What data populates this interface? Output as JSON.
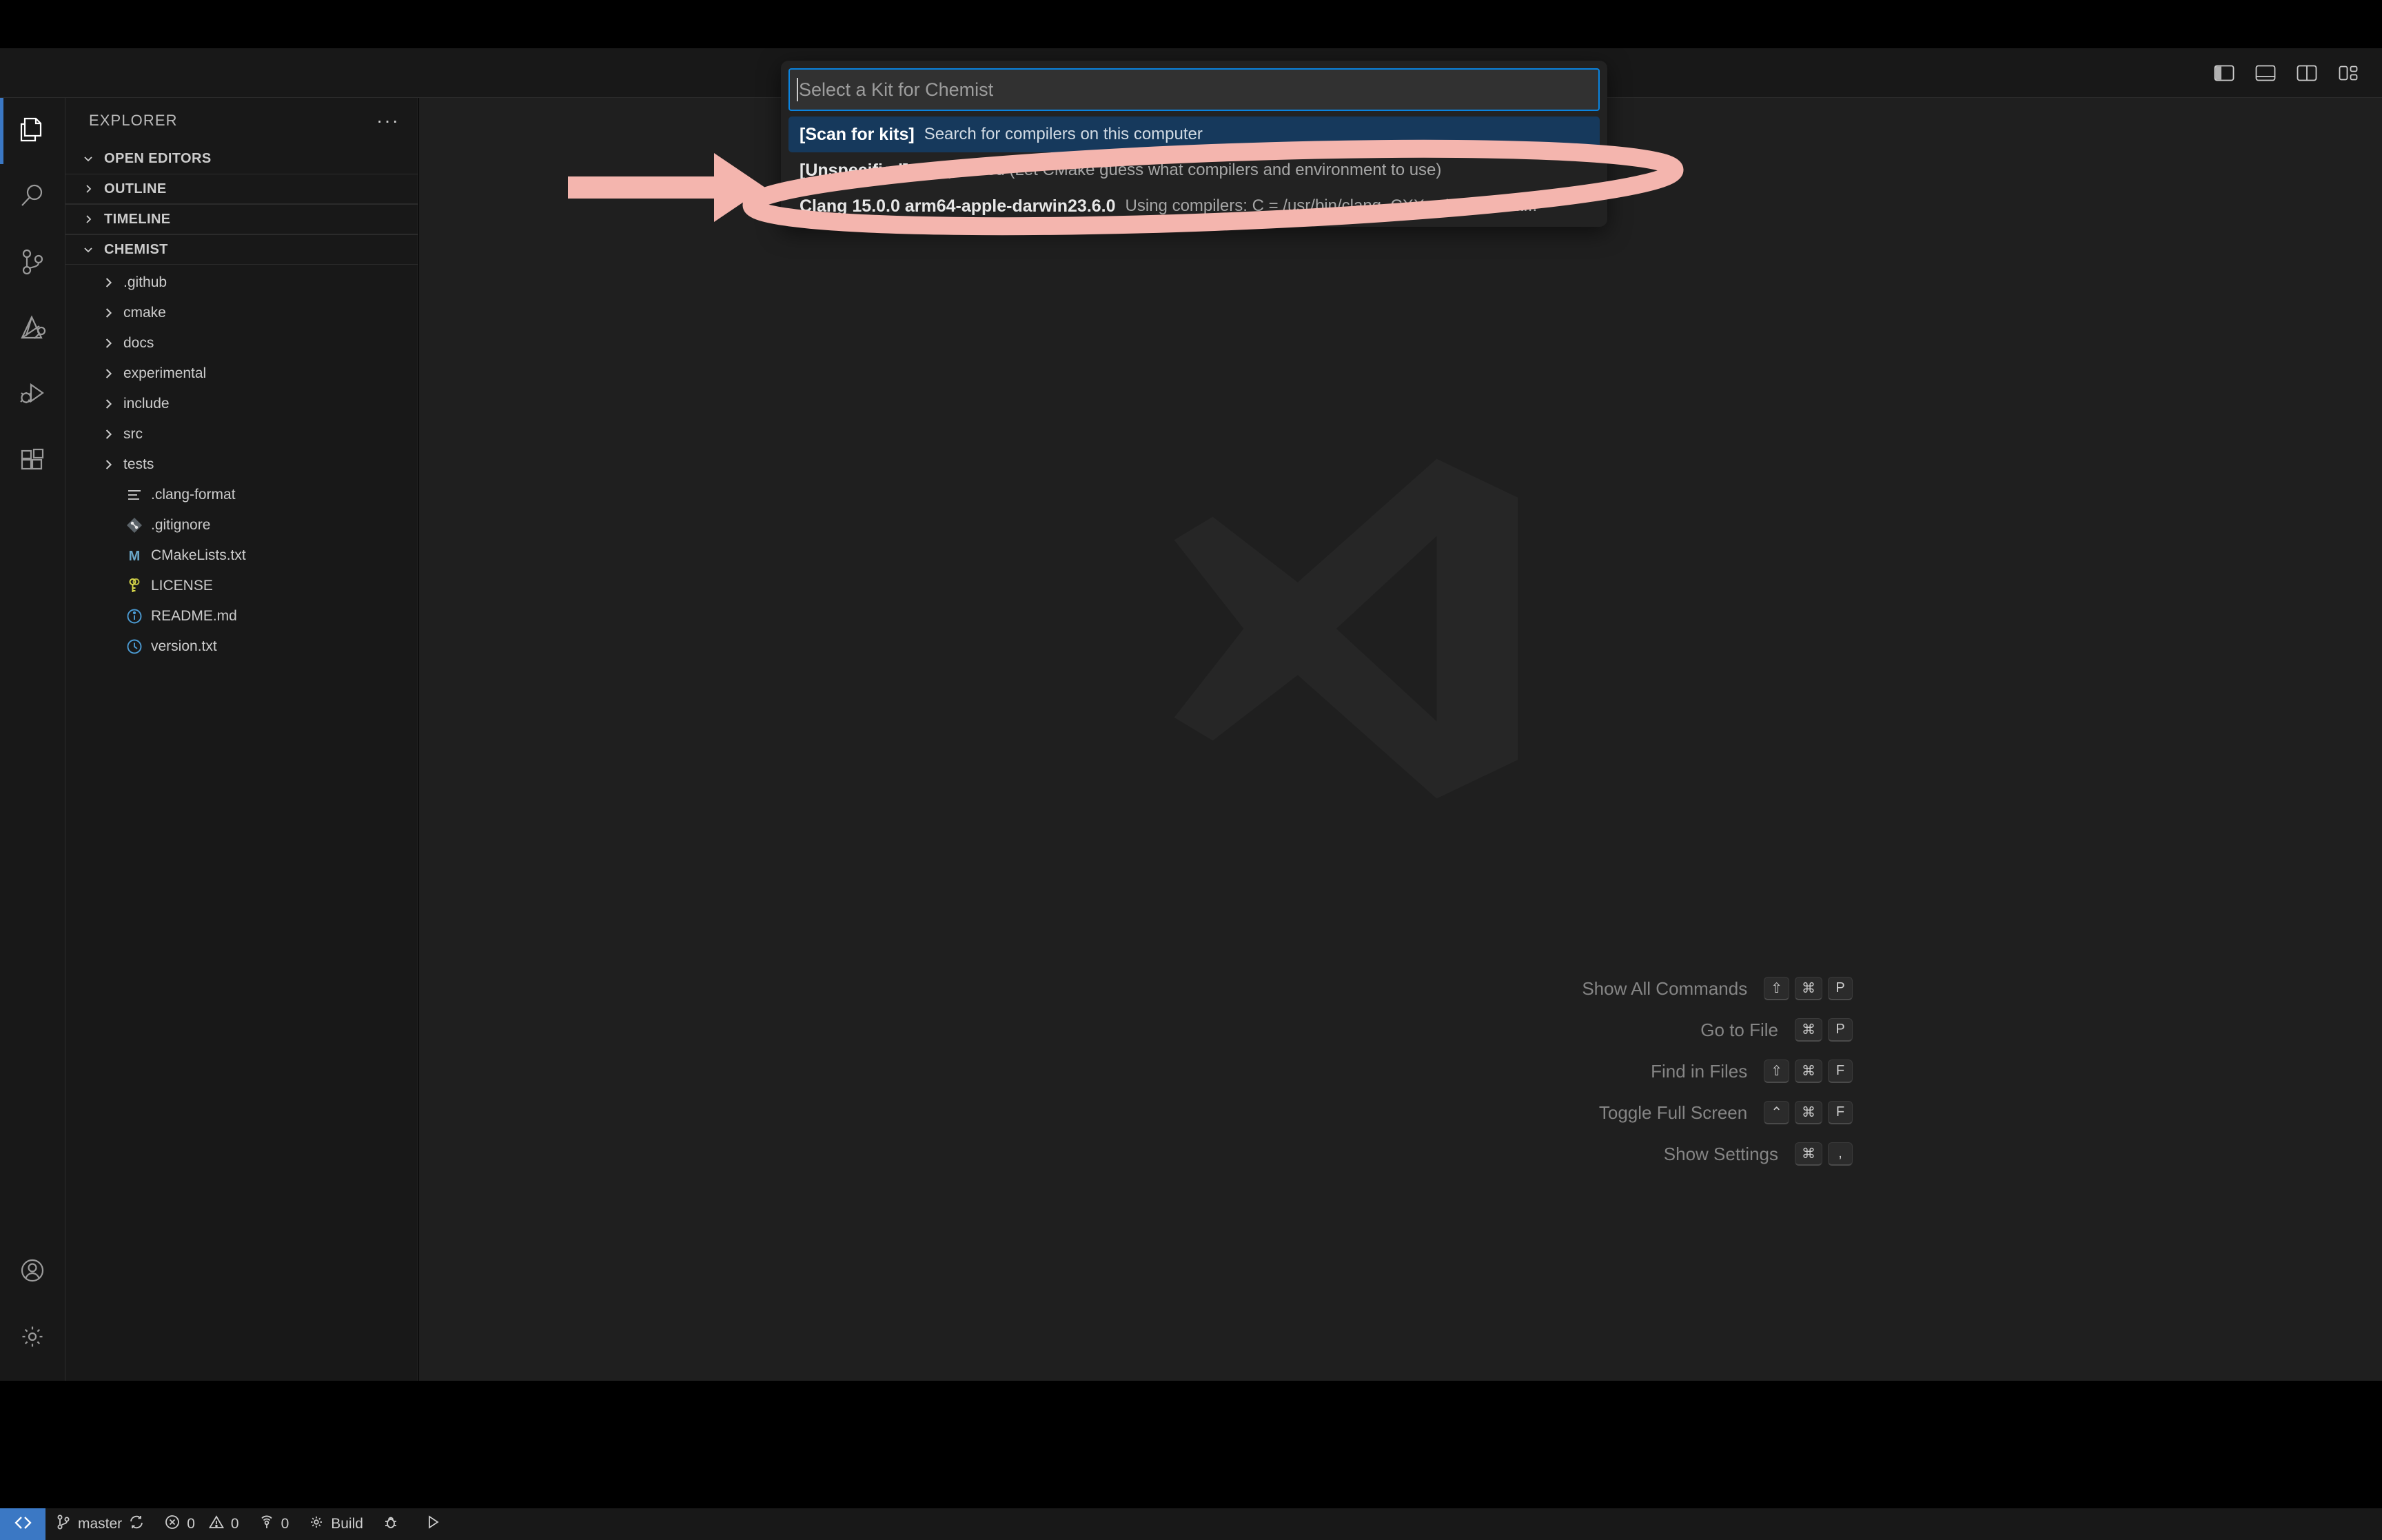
{
  "window": {
    "title_bar": {
      "layout_buttons": [
        {
          "name": "toggle-primary-sidebar",
          "label": "Toggle Primary Side Bar"
        },
        {
          "name": "toggle-panel",
          "label": "Toggle Panel"
        },
        {
          "name": "toggle-secondary-sidebar",
          "label": "Toggle Secondary Side Bar"
        },
        {
          "name": "customize-layout",
          "label": "Customize Layout"
        }
      ]
    }
  },
  "activity_bar": {
    "items": [
      {
        "icon": "files-icon",
        "label": "Explorer",
        "active": true
      },
      {
        "icon": "search-icon",
        "label": "Search",
        "active": false
      },
      {
        "icon": "source-control-icon",
        "label": "Source Control",
        "active": false
      },
      {
        "icon": "cmake-icon",
        "label": "CMake",
        "active": false
      },
      {
        "icon": "run-debug-icon",
        "label": "Run and Debug",
        "active": false
      },
      {
        "icon": "extensions-icon",
        "label": "Extensions",
        "active": false
      }
    ],
    "bottom_items": [
      {
        "icon": "account-icon",
        "label": "Accounts"
      },
      {
        "icon": "gear-icon",
        "label": "Manage"
      }
    ]
  },
  "sidebar": {
    "title": "EXPLORER",
    "more_actions": "···",
    "sections": [
      {
        "label": "OPEN EDITORS",
        "expanded": true
      },
      {
        "label": "OUTLINE",
        "expanded": false
      },
      {
        "label": "TIMELINE",
        "expanded": false
      },
      {
        "label": "CHEMIST",
        "expanded": true
      }
    ],
    "tree": [
      {
        "label": ".github",
        "type": "folder",
        "expanded": false
      },
      {
        "label": "cmake",
        "type": "folder",
        "expanded": false
      },
      {
        "label": "docs",
        "type": "folder",
        "expanded": false
      },
      {
        "label": "experimental",
        "type": "folder",
        "expanded": false
      },
      {
        "label": "include",
        "type": "folder",
        "expanded": false
      },
      {
        "label": "src",
        "type": "folder",
        "expanded": false
      },
      {
        "label": "tests",
        "type": "folder",
        "expanded": false
      },
      {
        "label": ".clang-format",
        "type": "file",
        "icon": "config-lines-icon"
      },
      {
        "label": ".gitignore",
        "type": "file",
        "icon": "git-icon"
      },
      {
        "label": "CMakeLists.txt",
        "type": "file",
        "icon": "cmake-m-icon"
      },
      {
        "label": "LICENSE",
        "type": "file",
        "icon": "key-icon"
      },
      {
        "label": "README.md",
        "type": "file",
        "icon": "info-icon"
      },
      {
        "label": "version.txt",
        "type": "file",
        "icon": "clock-icon"
      }
    ]
  },
  "editor": {
    "watermark": {
      "shortcuts": [
        {
          "label": "Show All Commands",
          "keys": [
            "⇧",
            "⌘",
            "P"
          ]
        },
        {
          "label": "Go to File",
          "keys": [
            "⌘",
            "P"
          ]
        },
        {
          "label": "Find in Files",
          "keys": [
            "⇧",
            "⌘",
            "F"
          ]
        },
        {
          "label": "Toggle Full Screen",
          "keys": [
            "⌃",
            "⌘",
            "F"
          ]
        },
        {
          "label": "Show Settings",
          "keys": [
            "⌘",
            ","
          ]
        }
      ]
    }
  },
  "quick_pick": {
    "input": {
      "value": "",
      "placeholder": "Select a Kit for Chemist"
    },
    "items": [
      {
        "label": "[Scan for kits]",
        "description": "Search for compilers on this computer",
        "selected": true
      },
      {
        "label": "[Unspecified]",
        "description": "Unspecified (Let CMake guess what compilers and environment to use)",
        "selected": false
      },
      {
        "label": "Clang 15.0.0 arm64-apple-darwin23.6.0",
        "description": "Using compilers: C = /usr/bin/clang, CXX = /usr/bin/cla...",
        "selected": false
      }
    ]
  },
  "annotations": {
    "color": "#f4b5ae",
    "arrow": {
      "name": "pointer-arrow",
      "points_to": "Clang 15.0.0 arm64-apple-darwin23.6.0"
    },
    "ellipse": {
      "name": "highlight-ellipse",
      "encircles": "Clang 15.0.0 arm64-apple-darwin23.6.0"
    }
  },
  "status_bar": {
    "remote_label": "",
    "items": [
      {
        "icon": "source-control-icon",
        "label": "master",
        "trailing_icon": "sync-icon"
      },
      {
        "icon": "error-icon",
        "label": "0",
        "second_icon": "warning-icon",
        "second_label": "0"
      },
      {
        "icon": "ports-icon",
        "label": "0"
      },
      {
        "icon": "gear-icon",
        "label": "Build"
      },
      {
        "icon": "bug-icon",
        "label": ""
      },
      {
        "icon": "play-icon",
        "label": ""
      }
    ]
  },
  "colors": {
    "accent_blue": "#3b78c4",
    "focus_border": "#0a84e0",
    "selection_bg": "#16395c",
    "annotation_pink": "#f4b5ae",
    "editor_bg": "#1f1f1f",
    "chrome_bg": "#181818"
  }
}
